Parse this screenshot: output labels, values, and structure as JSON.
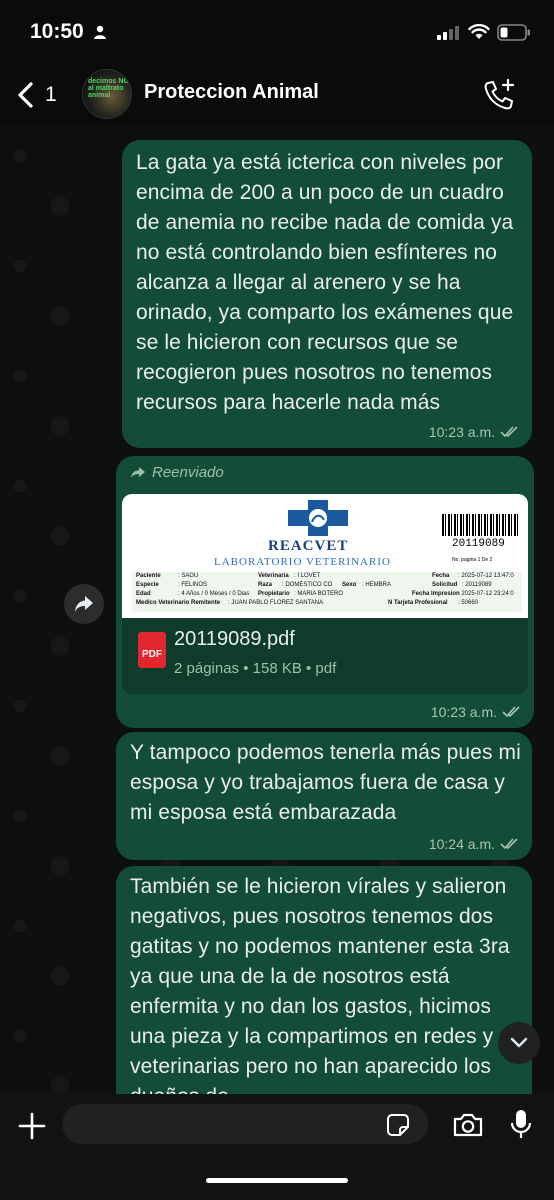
{
  "status_bar": {
    "time": "10:50"
  },
  "header": {
    "back_count": "1",
    "title": "Proteccion Animal",
    "avatar_line1": "decimos NO",
    "avatar_line2": "al maltrato animal"
  },
  "messages": [
    {
      "text": "La gata ya está icterica con niveles por encima de 200 a un poco de un cuadro de anemia no recibe nada de comida ya no está controlando bien esfínteres no alcanza a llegar al arenero y se ha orinado, ya comparto los exámenes que se le hicieron con recursos que se recogieron pues nosotros no tenemos recursos para hacerle nada más",
      "time": "10:23 a.m."
    },
    {
      "forwarded_label": "Reenviado",
      "document": {
        "lab_name": "REACVET",
        "lab_subtitle": "LABORATORIO VETERINARIO",
        "barcode_number": "20119089",
        "page_label": "No. pagina",
        "page_value": "1",
        "page_of": "De",
        "page_total": "2",
        "rows": [
          [
            "Paciente",
            ": SAGU",
            "Veterinaria",
            ": I LOVET",
            "Fecha",
            ": 2025-07-12 13:47:0"
          ],
          [
            "Especie",
            ": FELINOS",
            "Raza",
            ": DOMESTICO CO",
            "Sexo",
            ": HEMBRA",
            "Solicitud",
            ": 20119089"
          ],
          [
            "Edad",
            ": 4 Años / 0 Meses / 0 Dias",
            "Propietario",
            ": MARIA BOTERO",
            "Fecha Impresion",
            ": 2025-07-12 23:24:0"
          ],
          [
            "Medico Veterinario Remitente",
            ": JUAN PABLO FLOREZ SANTANA",
            "N Tarjeta Profesional",
            ": 50660"
          ]
        ],
        "file_name": "20119089.pdf",
        "file_info": "2 páginas • 158 KB • pdf",
        "pdf_badge": "PDF"
      },
      "time": "10:23 a.m."
    },
    {
      "text": "Y tampoco podemos tenerla más pues mi esposa y yo trabajamos fuera de casa y mi esposa está embarazada",
      "time": "10:24 a.m."
    },
    {
      "text": "También se le hicieron vírales y salieron negativos, pues nosotros tenemos dos gatitas y no podemos mantener esta 3ra ya que una de la de nosotros está enfermita y no dan los gastos, hicimos una pieza y la compartimos en redes y veterinarias pero no han aparecido los dueños de"
    }
  ],
  "input": {
    "value": ""
  },
  "colors": {
    "bubble": "#144d37",
    "background": "#0b0b0b",
    "accent": "#53bdeb"
  }
}
